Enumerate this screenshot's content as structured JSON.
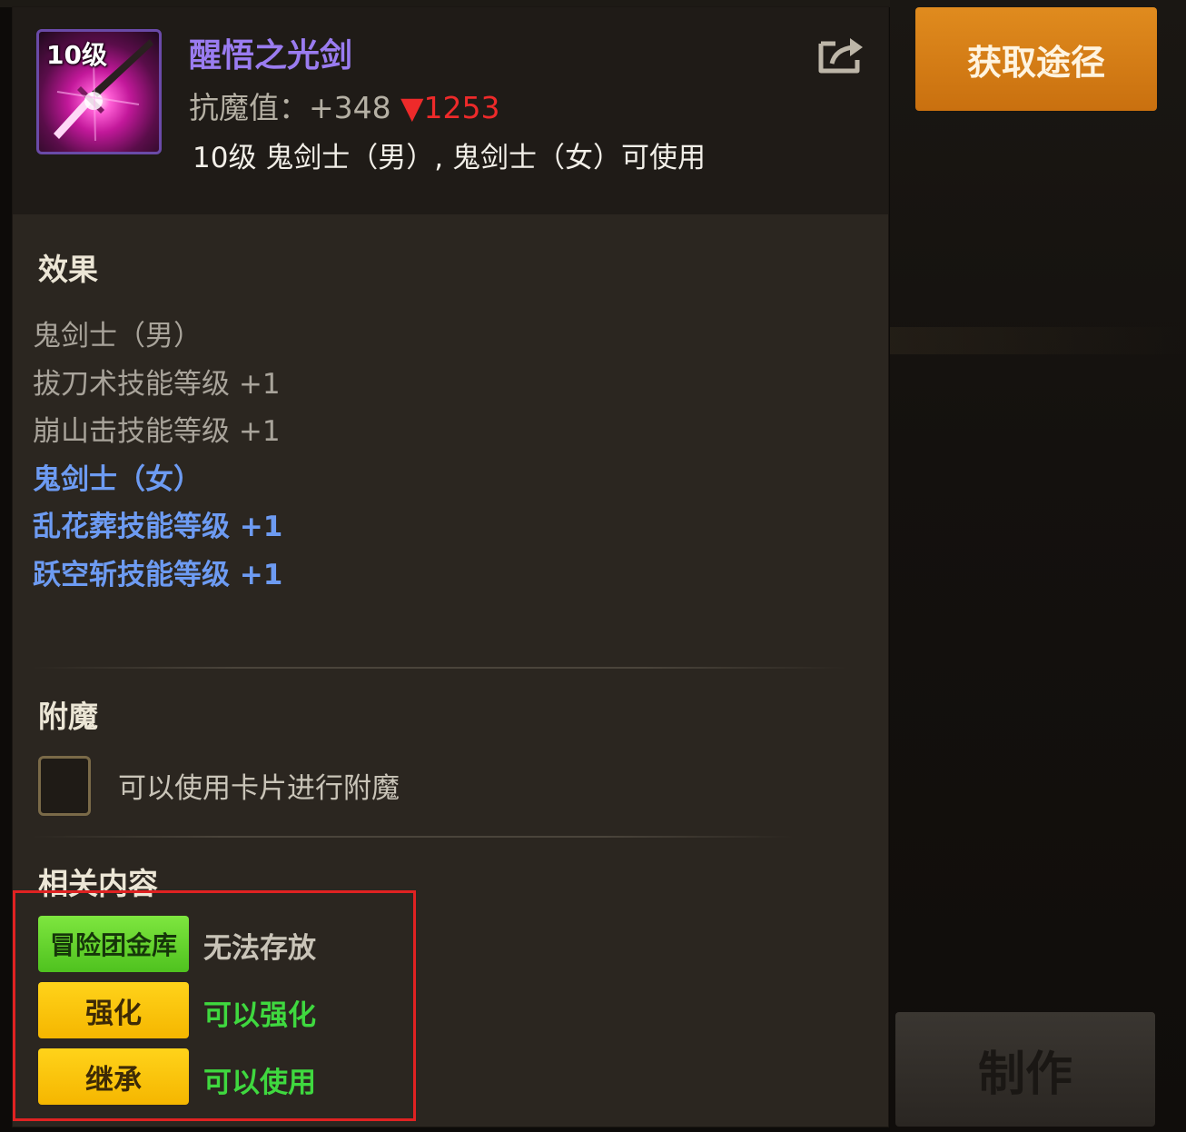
{
  "item": {
    "level_badge": "10级",
    "name": "醒悟之光剑",
    "stat_label": "抗魔值：",
    "stat_value": "+348",
    "stat_drop_arrow": "▼",
    "stat_drop_value": "1253",
    "requirement": "10级 鬼剑士（男）, 鬼剑士（女）可使用",
    "name_color": "#9a7cf0",
    "drop_color": "#ee2a2a"
  },
  "effects": {
    "title": "效果",
    "lines": [
      {
        "text": "鬼剑士（男）",
        "style": "gray"
      },
      {
        "text": "拔刀术技能等级 +1",
        "style": "gray"
      },
      {
        "text": "崩山击技能等级 +1",
        "style": "gray"
      },
      {
        "text": "鬼剑士（女）",
        "style": "blue"
      },
      {
        "text": "乱花葬技能等级 +1",
        "style": "blue"
      },
      {
        "text": "跃空斩技能等级 +1",
        "style": "blue"
      }
    ]
  },
  "enchant": {
    "title": "附魔",
    "description": "可以使用卡片进行附魔"
  },
  "related": {
    "title": "相关内容",
    "rows": [
      {
        "badge": "冒险团金库",
        "value": "无法存放",
        "badge_color": "green",
        "value_color": "#c9c4b8"
      },
      {
        "badge": "强化",
        "value": "可以强化",
        "badge_color": "yellow",
        "value_color": "#3fd83f"
      },
      {
        "badge": "继承",
        "value": "可以使用",
        "badge_color": "yellow",
        "value_color": "#3fd83f"
      }
    ]
  },
  "actions": {
    "acquire_label": "获取途径",
    "make_label": "制作"
  },
  "icons": {
    "share": "share-icon",
    "weapon": "sword-icon"
  }
}
